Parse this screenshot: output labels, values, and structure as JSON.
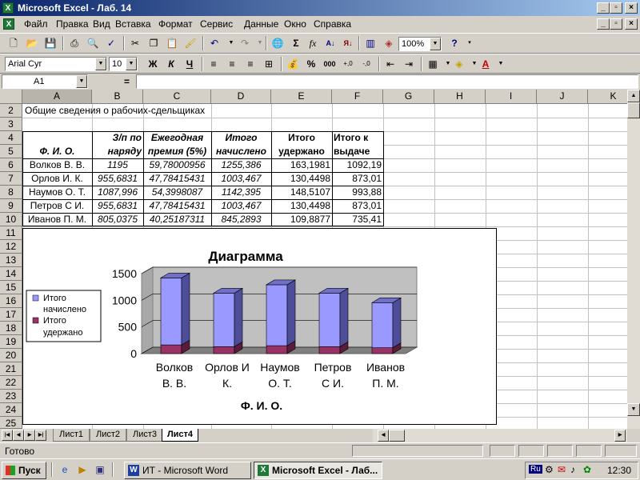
{
  "window": {
    "title": "Microsoft Excel - Лаб. 14"
  },
  "menu": [
    "Файл",
    "Правка",
    "Вид",
    "Вставка",
    "Формат",
    "Сервис",
    "Данные",
    "Окно",
    "Справка"
  ],
  "toolbar": {
    "zoom": "100%"
  },
  "format": {
    "font": "Arial Cyr",
    "size": "10",
    "bold": "Ж",
    "italic": "К",
    "underline": "Ч",
    "percent": "%",
    "thousands": "000"
  },
  "formula": {
    "name_box": "A1",
    "eq": "="
  },
  "columns": [
    "A",
    "B",
    "C",
    "D",
    "E",
    "F",
    "G",
    "H",
    "I",
    "J",
    "K"
  ],
  "rows": [
    "2",
    "3",
    "4",
    "5",
    "6",
    "7",
    "8",
    "9",
    "10",
    "11",
    "12",
    "13",
    "14",
    "15",
    "16",
    "17",
    "18",
    "19",
    "20",
    "21",
    "22",
    "23",
    "24",
    "25"
  ],
  "sheet": {
    "title": "Общие сведения о рабочих-сдельщиках",
    "headers": {
      "a": "Ф. И. О.",
      "b1": "З/п по",
      "b2": "наряду",
      "c1": "Ежегодная",
      "c2": "премия (5%)",
      "d1": "Итого",
      "d2": "начислено",
      "e1": "Итого",
      "e2": "удержано",
      "f1": "Итого к",
      "f2": "выдаче"
    },
    "data": [
      [
        "Волков В. В.",
        "1195",
        "59,78000956",
        "1255,386",
        "163,1981",
        "1092,19"
      ],
      [
        "Орлов И. К.",
        "955,6831",
        "47,78415431",
        "1003,467",
        "130,4498",
        "873,01"
      ],
      [
        "Наумов О. Т.",
        "1087,996",
        "54,3998087",
        "1142,395",
        "148,5107",
        "993,88"
      ],
      [
        "Петров С И.",
        "955,6831",
        "47,78415431",
        "1003,467",
        "130,4498",
        "873,01"
      ],
      [
        "Иванов П. М.",
        "805,0375",
        "40,25187311",
        "845,2893",
        "109,8877",
        "735,41"
      ]
    ]
  },
  "chart_data": {
    "type": "bar",
    "title": "Диаграмма",
    "xlabel": "Ф. И. О.",
    "categories": [
      [
        "Волков",
        "В. В."
      ],
      [
        "Орлов И",
        "К."
      ],
      [
        "Наумов",
        "О. Т."
      ],
      [
        "Петров",
        "С И."
      ],
      [
        "Иванов",
        "П. М."
      ]
    ],
    "series": [
      {
        "name": [
          "Итого",
          "начислено"
        ],
        "values": [
          1255.386,
          1003.467,
          1142.395,
          1003.467,
          845.2893
        ],
        "color": "#9999ff"
      },
      {
        "name": [
          "Итого",
          "удержано"
        ],
        "values": [
          163.1981,
          130.4498,
          148.5107,
          130.4498,
          109.8877
        ],
        "color": "#993366"
      }
    ],
    "stacked": true,
    "yticks": [
      "0",
      "500",
      "1000",
      "1500"
    ],
    "ylim": [
      0,
      1500
    ],
    "legend": "left"
  },
  "tabs": [
    "Лист1",
    "Лист2",
    "Лист3",
    "Лист4"
  ],
  "active_tab": 3,
  "status": {
    "text": "Готово"
  },
  "taskbar": {
    "start": "Пуск",
    "word": "ИТ - Microsoft Word",
    "excel": "Microsoft Excel - Лаб...",
    "lang": "Ru",
    "clock": "12:30"
  },
  "colors": {
    "title_start": "#0a246a",
    "title_end": "#a6caf0",
    "bar_front": "#9999ff",
    "bar_side": "#4d4d99",
    "bar2": "#993366"
  }
}
